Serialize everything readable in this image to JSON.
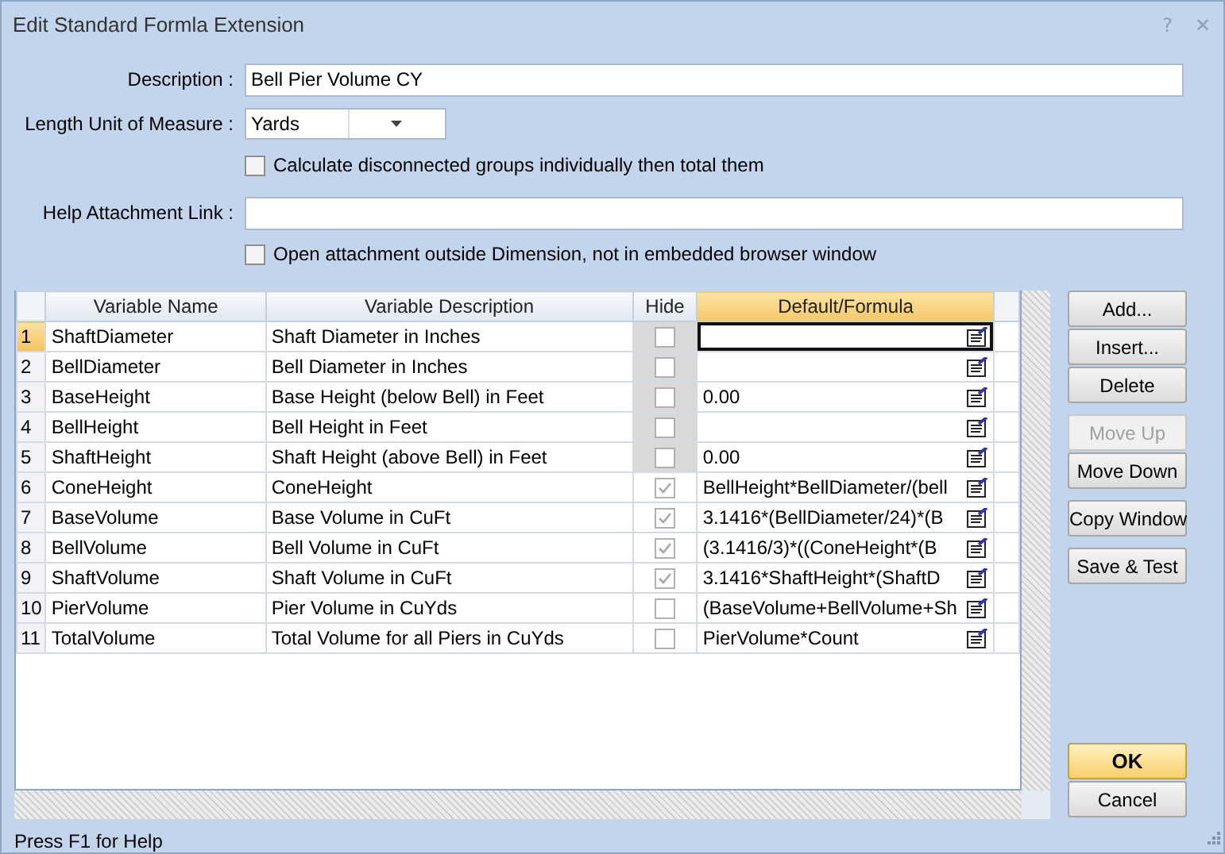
{
  "window": {
    "title": "Edit Standard Formla Extension",
    "help_glyph": "?",
    "close_glyph": "✕"
  },
  "form": {
    "description_label": "Description :",
    "description_value": "Bell Pier Volume CY",
    "unit_label": "Length Unit of Measure :",
    "unit_value": "Yards",
    "calc_separately": {
      "label": "Calculate disconnected groups individually then total them",
      "checked": false
    },
    "help_link_label": "Help Attachment Link :",
    "open_outside": {
      "label": "Open attachment outside Dimension, not in embedded browser window",
      "checked": false
    }
  },
  "table": {
    "columns": [
      "Variable Name",
      "Variable Description",
      "Hide",
      "Default/Formula"
    ],
    "rows": [
      {
        "number": "1",
        "name": "ShaftDiameter",
        "description": "Shaft Diameter in Inches",
        "hide": false,
        "hide_disabled": true,
        "formula": "",
        "selected": true
      },
      {
        "number": "2",
        "name": "BellDiameter",
        "description": "Bell Diameter in Inches",
        "hide": false,
        "hide_disabled": true,
        "formula": "",
        "selected": false
      },
      {
        "number": "3",
        "name": "BaseHeight",
        "description": "Base Height (below Bell) in Feet",
        "hide": false,
        "hide_disabled": true,
        "formula": "0.00",
        "selected": false
      },
      {
        "number": "4",
        "name": "BellHeight",
        "description": "Bell Height in Feet",
        "hide": false,
        "hide_disabled": true,
        "formula": "",
        "selected": false
      },
      {
        "number": "5",
        "name": "ShaftHeight",
        "description": "Shaft Height (above Bell) in Feet",
        "hide": false,
        "hide_disabled": true,
        "formula": "0.00",
        "selected": false
      },
      {
        "number": "6",
        "name": "ConeHeight",
        "description": "ConeHeight",
        "hide": true,
        "hide_disabled": false,
        "formula": "BellHeight*BellDiameter/(bell",
        "selected": false
      },
      {
        "number": "7",
        "name": "BaseVolume",
        "description": "Base Volume in CuFt",
        "hide": true,
        "hide_disabled": false,
        "formula": "3.1416*(BellDiameter/24)*(B",
        "selected": false
      },
      {
        "number": "8",
        "name": "BellVolume",
        "description": "Bell Volume in CuFt",
        "hide": true,
        "hide_disabled": false,
        "formula": "(3.1416/3)*((ConeHeight*(B",
        "selected": false
      },
      {
        "number": "9",
        "name": "ShaftVolume",
        "description": "Shaft Volume in CuFt",
        "hide": true,
        "hide_disabled": false,
        "formula": "3.1416*ShaftHeight*(ShaftD",
        "selected": false
      },
      {
        "number": "10",
        "name": "PierVolume",
        "description": "Pier Volume in CuYds",
        "hide": false,
        "hide_disabled": false,
        "formula": "(BaseVolume+BellVolume+Sh",
        "selected": false
      },
      {
        "number": "11",
        "name": "TotalVolume",
        "description": "Total Volume for all Piers in CuYds",
        "hide": false,
        "hide_disabled": false,
        "formula": "PierVolume*Count",
        "selected": false
      }
    ]
  },
  "side_buttons": [
    {
      "label": "Add...",
      "disabled": false
    },
    {
      "label": "Insert...",
      "disabled": false
    },
    {
      "label": "Delete",
      "disabled": false
    },
    {
      "label": "Move Up",
      "disabled": true
    },
    {
      "label": "Move Down",
      "disabled": false
    },
    {
      "label": "Copy Window",
      "disabled": false
    },
    {
      "label": "Save & Test",
      "disabled": false
    }
  ],
  "dialog_buttons": [
    {
      "label": "OK",
      "default": true
    },
    {
      "label": "Cancel",
      "default": false
    }
  ],
  "status_bar": "Press F1 for Help"
}
